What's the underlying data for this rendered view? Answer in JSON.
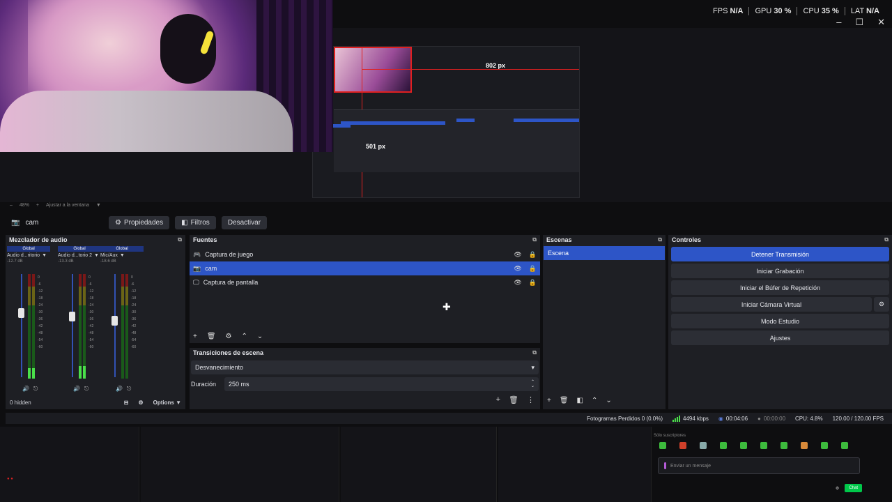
{
  "stats": [
    {
      "label": "FPS",
      "value": "N/A"
    },
    {
      "label": "GPU",
      "value": "30 %"
    },
    {
      "label": "CPU",
      "value": "35 %"
    },
    {
      "label": "LAT",
      "value": "N/A"
    }
  ],
  "preview": {
    "measure_h": "802 px",
    "measure_v": "501 px",
    "zoom": "48%",
    "fit_label": "Ajustar a la ventana"
  },
  "toolbar": {
    "source_name": "cam",
    "properties": "Propiedades",
    "filters": "Filtros",
    "deactivate": "Desactivar"
  },
  "mixer": {
    "title": "Mezclador de audio",
    "channels": [
      {
        "global": "Global",
        "name": "Audio d...ritorio",
        "db": "-12.7 dB",
        "level": 0.1,
        "fader": 0.62
      },
      {
        "global": "Global",
        "name": "Audio d...torio 2",
        "db": "-13.3 dB",
        "level": 0.12,
        "fader": 0.59
      },
      {
        "global": "Global",
        "name": "Mic/Aux",
        "db": "-18.6 dB",
        "level": 0.0,
        "fader": 0.55
      }
    ],
    "scale": [
      "0",
      "-6",
      "-12",
      "-18",
      "-24",
      "-30",
      "-36",
      "-42",
      "-48",
      "-54",
      "-60"
    ],
    "hidden": "0 hidden",
    "options": "Options"
  },
  "sources": {
    "title": "Fuentes",
    "items": [
      {
        "name": "Captura de juego",
        "icon": "gamepad-icon",
        "active": false
      },
      {
        "name": "cam",
        "icon": "camera-icon",
        "active": true
      },
      {
        "name": "Captura de pantalla",
        "icon": "monitor-icon",
        "active": false
      }
    ]
  },
  "transitions": {
    "title": "Transiciones de escena",
    "selected": "Desvanecimiento",
    "duration_label": "Duración",
    "duration_value": "250 ms"
  },
  "scenes": {
    "title": "Escenas",
    "items": [
      "Escena"
    ]
  },
  "controls": {
    "title": "Controles",
    "stop_stream": "Detener Transmisión",
    "start_recording": "Iniciar Grabación",
    "start_replay": "Iniciar el Búfer de Repetición",
    "start_virtualcam": "Iniciar Cámara Virtual",
    "studio_mode": "Modo Estudio",
    "settings": "Ajustes"
  },
  "status": {
    "dropped_frames": "Fotogramas Perdidos 0 (0.0%)",
    "bitrate": "4494 kbps",
    "stream_time": "00:04:06",
    "rec_time": "00:00:00",
    "cpu": "CPU: 4.8%",
    "fps": "120.00 / 120.00 FPS"
  },
  "chat": {
    "mode_label": "Sólo suscriptores",
    "placeholder": "Enviar un mensaje",
    "send": "Chat"
  },
  "colors": {
    "accent": "#2d55c7",
    "panel": "#1e1f24",
    "background": "#0e0e10"
  }
}
